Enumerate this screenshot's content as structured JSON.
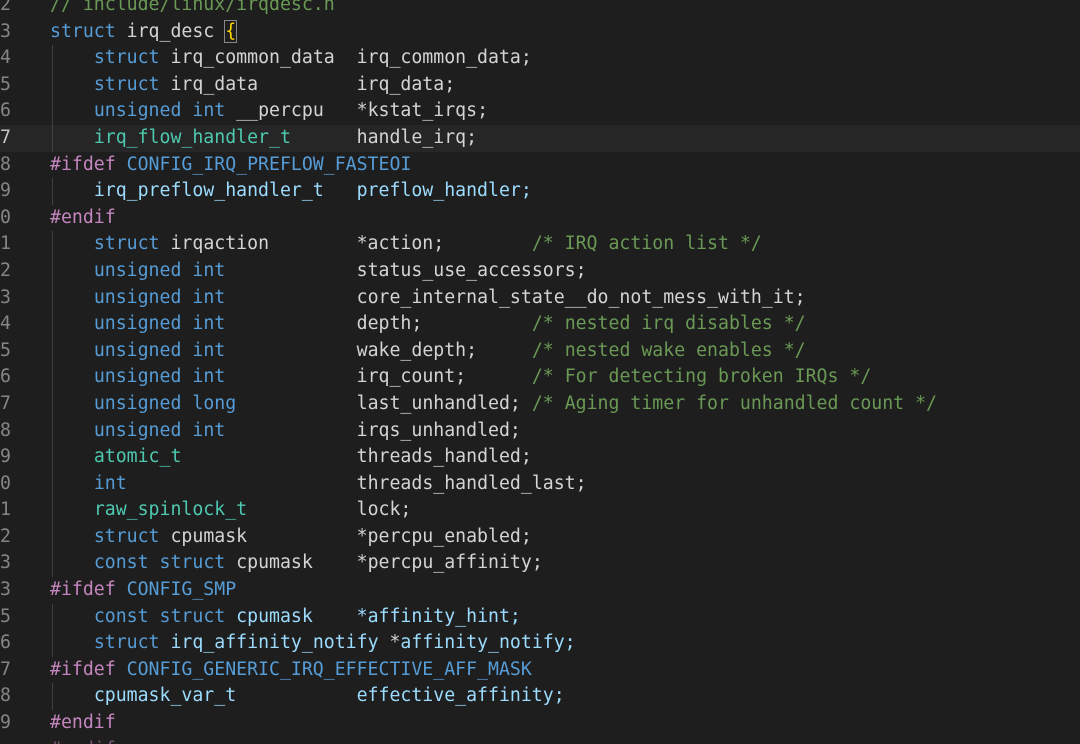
{
  "editor": {
    "language": "C",
    "colors": {
      "background": "#1e1e1e",
      "keyword": "#569cd6",
      "type": "#4ec9b0",
      "preprocessor": "#c586c0",
      "comment": "#6a9955",
      "identifier": "#d4d4d4",
      "inactive_member": "#9cdcfe"
    },
    "current_line_number": "7",
    "lines": [
      {
        "n": "2",
        "guide": false,
        "tokens": [
          {
            "t": "// include/linux/irqdesc.h",
            "c": "cm"
          }
        ]
      },
      {
        "n": "3",
        "guide": false,
        "tokens": [
          {
            "t": "struct",
            "c": "kw"
          },
          {
            "t": " irq_desc ",
            "c": "id"
          },
          {
            "t": "{",
            "c": "brace"
          }
        ]
      },
      {
        "n": "4",
        "guide": true,
        "tokens": [
          {
            "t": "    ",
            "c": "id"
          },
          {
            "t": "struct",
            "c": "kw"
          },
          {
            "t": " irq_common_data  irq_common_data;",
            "c": "id"
          }
        ]
      },
      {
        "n": "5",
        "guide": true,
        "tokens": [
          {
            "t": "    ",
            "c": "id"
          },
          {
            "t": "struct",
            "c": "kw"
          },
          {
            "t": " irq_data         irq_data;",
            "c": "id"
          }
        ]
      },
      {
        "n": "6",
        "guide": true,
        "tokens": [
          {
            "t": "    ",
            "c": "id"
          },
          {
            "t": "unsigned",
            "c": "kw"
          },
          {
            "t": " ",
            "c": "id"
          },
          {
            "t": "int",
            "c": "kw"
          },
          {
            "t": " __percpu   *kstat_irqs;",
            "c": "id"
          }
        ]
      },
      {
        "n": "7",
        "guide": true,
        "current": true,
        "tokens": [
          {
            "t": "    ",
            "c": "id"
          },
          {
            "t": "irq_flow_handler_t",
            "c": "type"
          },
          {
            "t": "      handle_irq;",
            "c": "id"
          }
        ]
      },
      {
        "n": "8",
        "guide": false,
        "tokens": [
          {
            "t": "#ifdef",
            "c": "pp"
          },
          {
            "t": " CONFIG_IRQ_PREFLOW_FASTEOI",
            "c": "macro"
          }
        ]
      },
      {
        "n": "9",
        "guide": true,
        "tokens": [
          {
            "t": "    ",
            "c": "id"
          },
          {
            "t": "irq_preflow_handler_t   preflow_handler;",
            "c": "member"
          }
        ]
      },
      {
        "n": "0",
        "guide": false,
        "tokens": [
          {
            "t": "#endif",
            "c": "pp"
          }
        ]
      },
      {
        "n": "1",
        "guide": true,
        "tokens": [
          {
            "t": "    ",
            "c": "id"
          },
          {
            "t": "struct",
            "c": "kw"
          },
          {
            "t": " irqaction        *action;        ",
            "c": "id"
          },
          {
            "t": "/* IRQ action list */",
            "c": "cm"
          }
        ]
      },
      {
        "n": "2",
        "guide": true,
        "tokens": [
          {
            "t": "    ",
            "c": "id"
          },
          {
            "t": "unsigned",
            "c": "kw"
          },
          {
            "t": " ",
            "c": "id"
          },
          {
            "t": "int",
            "c": "kw"
          },
          {
            "t": "            status_use_accessors;",
            "c": "id"
          }
        ]
      },
      {
        "n": "3",
        "guide": true,
        "tokens": [
          {
            "t": "    ",
            "c": "id"
          },
          {
            "t": "unsigned",
            "c": "kw"
          },
          {
            "t": " ",
            "c": "id"
          },
          {
            "t": "int",
            "c": "kw"
          },
          {
            "t": "            core_internal_state__do_not_mess_with_it;",
            "c": "id"
          }
        ]
      },
      {
        "n": "4",
        "guide": true,
        "tokens": [
          {
            "t": "    ",
            "c": "id"
          },
          {
            "t": "unsigned",
            "c": "kw"
          },
          {
            "t": " ",
            "c": "id"
          },
          {
            "t": "int",
            "c": "kw"
          },
          {
            "t": "            depth;          ",
            "c": "id"
          },
          {
            "t": "/* nested irq disables */",
            "c": "cm"
          }
        ]
      },
      {
        "n": "5",
        "guide": true,
        "tokens": [
          {
            "t": "    ",
            "c": "id"
          },
          {
            "t": "unsigned",
            "c": "kw"
          },
          {
            "t": " ",
            "c": "id"
          },
          {
            "t": "int",
            "c": "kw"
          },
          {
            "t": "            wake_depth;     ",
            "c": "id"
          },
          {
            "t": "/* nested wake enables */",
            "c": "cm"
          }
        ]
      },
      {
        "n": "6",
        "guide": true,
        "tokens": [
          {
            "t": "    ",
            "c": "id"
          },
          {
            "t": "unsigned",
            "c": "kw"
          },
          {
            "t": " ",
            "c": "id"
          },
          {
            "t": "int",
            "c": "kw"
          },
          {
            "t": "            irq_count;      ",
            "c": "id"
          },
          {
            "t": "/* For detecting broken IRQs */",
            "c": "cm"
          }
        ]
      },
      {
        "n": "7",
        "guide": true,
        "tokens": [
          {
            "t": "    ",
            "c": "id"
          },
          {
            "t": "unsigned",
            "c": "kw"
          },
          {
            "t": " ",
            "c": "id"
          },
          {
            "t": "long",
            "c": "kw"
          },
          {
            "t": "           last_unhandled; ",
            "c": "id"
          },
          {
            "t": "/* Aging timer for unhandled count */",
            "c": "cm"
          }
        ]
      },
      {
        "n": "8",
        "guide": true,
        "tokens": [
          {
            "t": "    ",
            "c": "id"
          },
          {
            "t": "unsigned",
            "c": "kw"
          },
          {
            "t": " ",
            "c": "id"
          },
          {
            "t": "int",
            "c": "kw"
          },
          {
            "t": "            irqs_unhandled;",
            "c": "id"
          }
        ]
      },
      {
        "n": "9",
        "guide": true,
        "tokens": [
          {
            "t": "    ",
            "c": "id"
          },
          {
            "t": "atomic_t",
            "c": "type"
          },
          {
            "t": "                threads_handled;",
            "c": "id"
          }
        ]
      },
      {
        "n": "0",
        "guide": true,
        "tokens": [
          {
            "t": "    ",
            "c": "id"
          },
          {
            "t": "int",
            "c": "kw"
          },
          {
            "t": "                     threads_handled_last;",
            "c": "id"
          }
        ]
      },
      {
        "n": "1",
        "guide": true,
        "tokens": [
          {
            "t": "    ",
            "c": "id"
          },
          {
            "t": "raw_spinlock_t",
            "c": "type"
          },
          {
            "t": "          lock;",
            "c": "id"
          }
        ]
      },
      {
        "n": "2",
        "guide": true,
        "tokens": [
          {
            "t": "    ",
            "c": "id"
          },
          {
            "t": "struct",
            "c": "kw"
          },
          {
            "t": " cpumask          *percpu_enabled;",
            "c": "id"
          }
        ]
      },
      {
        "n": "3",
        "guide": true,
        "tokens": [
          {
            "t": "    ",
            "c": "id"
          },
          {
            "t": "const",
            "c": "kw"
          },
          {
            "t": " ",
            "c": "id"
          },
          {
            "t": "struct",
            "c": "kw"
          },
          {
            "t": " cpumask    *percpu_affinity;",
            "c": "id"
          }
        ]
      },
      {
        "n": "3",
        "guide": false,
        "tokens": [
          {
            "t": "#ifdef",
            "c": "pp"
          },
          {
            "t": " CONFIG_SMP",
            "c": "macro"
          }
        ]
      },
      {
        "n": "5",
        "guide": true,
        "tokens": [
          {
            "t": "    ",
            "c": "id"
          },
          {
            "t": "const",
            "c": "kw"
          },
          {
            "t": " ",
            "c": "id"
          },
          {
            "t": "struct",
            "c": "kw"
          },
          {
            "t": " ",
            "c": "id"
          },
          {
            "t": "cpumask    *affinity_hint;",
            "c": "member"
          }
        ]
      },
      {
        "n": "6",
        "guide": true,
        "tokens": [
          {
            "t": "    ",
            "c": "id"
          },
          {
            "t": "struct",
            "c": "kw"
          },
          {
            "t": " ",
            "c": "id"
          },
          {
            "t": "irq_affinity_notify",
            "c": "member"
          },
          {
            "t": " *",
            "c": "id"
          },
          {
            "t": "affinity_notify;",
            "c": "member"
          }
        ]
      },
      {
        "n": "7",
        "guide": false,
        "tokens": [
          {
            "t": "#ifdef",
            "c": "pp"
          },
          {
            "t": " CONFIG_GENERIC_IRQ_EFFECTIVE_AFF_MASK",
            "c": "macro"
          }
        ]
      },
      {
        "n": "8",
        "guide": true,
        "tokens": [
          {
            "t": "    ",
            "c": "id"
          },
          {
            "t": "cpumask_var_t           effective_affinity;",
            "c": "member"
          }
        ]
      },
      {
        "n": "9",
        "guide": false,
        "tokens": [
          {
            "t": "#endif",
            "c": "pp"
          }
        ]
      },
      {
        "n": "",
        "guide": false,
        "dim": true,
        "tokens": [
          {
            "t": "#endif",
            "c": "pp"
          }
        ]
      }
    ]
  }
}
